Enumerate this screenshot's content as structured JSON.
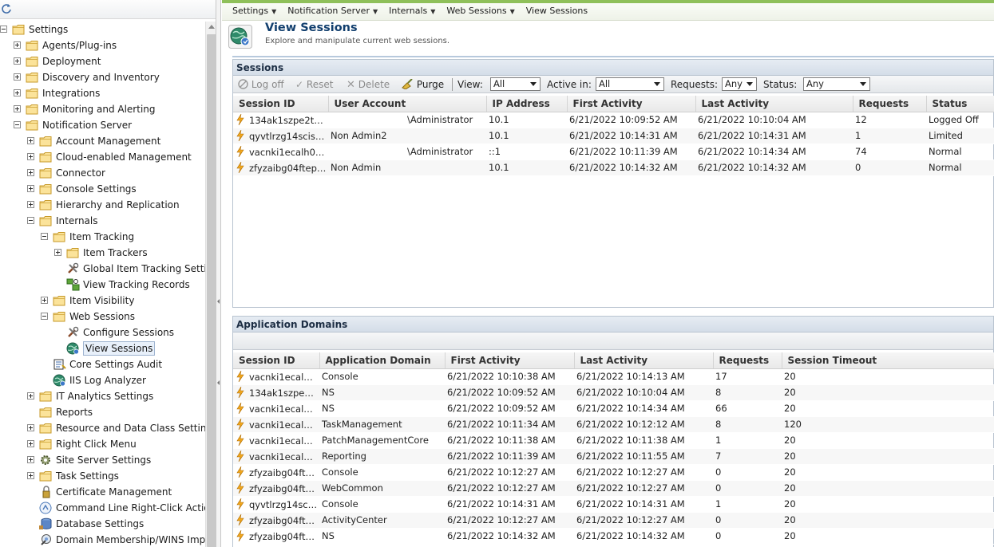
{
  "left_tree": {
    "items": [
      {
        "label": "Settings",
        "level": 0,
        "expander": "minus",
        "icon": "folder-icon"
      },
      {
        "label": "Agents/Plug-ins",
        "level": 1,
        "expander": "plus",
        "icon": "folder-icon"
      },
      {
        "label": "Deployment",
        "level": 1,
        "expander": "plus",
        "icon": "folder-icon"
      },
      {
        "label": "Discovery and Inventory",
        "level": 1,
        "expander": "plus",
        "icon": "folder-icon"
      },
      {
        "label": "Integrations",
        "level": 1,
        "expander": "plus",
        "icon": "folder-icon"
      },
      {
        "label": "Monitoring and Alerting",
        "level": 1,
        "expander": "plus",
        "icon": "folder-icon"
      },
      {
        "label": "Notification Server",
        "level": 1,
        "expander": "minus",
        "icon": "folder-icon"
      },
      {
        "label": "Account Management",
        "level": 2,
        "expander": "plus",
        "icon": "folder-icon"
      },
      {
        "label": "Cloud-enabled Management",
        "level": 2,
        "expander": "plus",
        "icon": "folder-icon"
      },
      {
        "label": "Connector",
        "level": 2,
        "expander": "plus",
        "icon": "folder-icon"
      },
      {
        "label": "Console Settings",
        "level": 2,
        "expander": "plus",
        "icon": "folder-icon"
      },
      {
        "label": "Hierarchy and Replication",
        "level": 2,
        "expander": "plus",
        "icon": "folder-icon"
      },
      {
        "label": "Internals",
        "level": 2,
        "expander": "minus",
        "icon": "folder-icon"
      },
      {
        "label": "Item Tracking",
        "level": 3,
        "expander": "minus",
        "icon": "folder-icon"
      },
      {
        "label": "Item Trackers",
        "level": 4,
        "expander": "plus",
        "icon": "folder-icon"
      },
      {
        "label": "Global Item Tracking Settin",
        "level": 4,
        "expander": "none",
        "icon": "tools-icon"
      },
      {
        "label": "View Tracking Records",
        "level": 4,
        "expander": "none",
        "icon": "records-icon"
      },
      {
        "label": "Item Visibility",
        "level": 3,
        "expander": "plus",
        "icon": "folder-icon"
      },
      {
        "label": "Web Sessions",
        "level": 3,
        "expander": "minus",
        "icon": "folder-icon"
      },
      {
        "label": "Configure Sessions",
        "level": 4,
        "expander": "none",
        "icon": "tools-icon"
      },
      {
        "label": "View Sessions",
        "level": 4,
        "expander": "none",
        "icon": "globe-icon",
        "selected": true
      },
      {
        "label": "Core Settings Audit",
        "level": 3,
        "expander": "none",
        "icon": "audit-icon"
      },
      {
        "label": "IIS Log Analyzer",
        "level": 3,
        "expander": "none",
        "icon": "globe-icon"
      },
      {
        "label": "IT Analytics Settings",
        "level": 2,
        "expander": "plus",
        "icon": "folder-icon"
      },
      {
        "label": "Reports",
        "level": 2,
        "expander": "none",
        "icon": "folder-icon"
      },
      {
        "label": "Resource and Data Class Settings",
        "level": 2,
        "expander": "plus",
        "icon": "folder-icon"
      },
      {
        "label": "Right Click Menu",
        "level": 2,
        "expander": "plus",
        "icon": "folder-icon"
      },
      {
        "label": "Site Server Settings",
        "level": 2,
        "expander": "plus",
        "icon": "gear-icon"
      },
      {
        "label": "Task Settings",
        "level": 2,
        "expander": "plus",
        "icon": "folder-icon"
      },
      {
        "label": "Certificate Management",
        "level": 2,
        "expander": "none",
        "icon": "certificate-icon"
      },
      {
        "label": "Command Line Right-Click Action",
        "level": 2,
        "expander": "none",
        "icon": "command-icon"
      },
      {
        "label": "Database Settings",
        "level": 2,
        "expander": "none",
        "icon": "database-icon"
      },
      {
        "label": "Domain Membership/WINS Impo",
        "level": 2,
        "expander": "none",
        "icon": "domain-icon"
      }
    ]
  },
  "breadcrumb": [
    {
      "label": "Settings",
      "has_menu": true
    },
    {
      "label": "Notification Server",
      "has_menu": true
    },
    {
      "label": "Internals",
      "has_menu": true
    },
    {
      "label": "Web Sessions",
      "has_menu": true
    },
    {
      "label": "View Sessions",
      "has_menu": false
    }
  ],
  "page": {
    "title": "View Sessions",
    "subtitle": "Explore and manipulate current web sessions.",
    "icon": "globe-icon"
  },
  "sessions_panel": {
    "title": "Sessions",
    "toolbar": {
      "log_off": "Log off",
      "reset": "Reset",
      "delete": "Delete",
      "purge": "Purge",
      "view_label": "View:",
      "view_value": "All",
      "active_in_label": "Active in:",
      "active_in_value": "All",
      "requests_label": "Requests:",
      "requests_value": "Any",
      "status_label": "Status:",
      "status_value": "Any"
    },
    "columns": [
      "Session ID",
      "User Account",
      "IP Address",
      "First Activity",
      "Last Activity",
      "Requests",
      "Status"
    ],
    "rows": [
      {
        "session_id": "134ak1szpe2t…",
        "user_account": "\\Administrator",
        "ip_address": "10.1",
        "first_activity": "6/21/2022 10:09:52 AM",
        "last_activity": "6/21/2022 10:10:04 AM",
        "requests": "12",
        "status": "Logged Off"
      },
      {
        "session_id": "qyvtlrzg14scis…",
        "user_account": "Non Admin2",
        "ip_address": "10.1",
        "first_activity": "6/21/2022 10:14:31 AM",
        "last_activity": "6/21/2022 10:14:31 AM",
        "requests": "1",
        "status": "Limited"
      },
      {
        "session_id": "vacnki1ecalh0…",
        "user_account": "\\Administrator",
        "ip_address": "::1",
        "first_activity": "6/21/2022 10:11:39 AM",
        "last_activity": "6/21/2022 10:14:34 AM",
        "requests": "74",
        "status": "Normal"
      },
      {
        "session_id": "zfyzaibg04ftep…",
        "user_account": "Non Admin",
        "ip_address": "10.1",
        "first_activity": "6/21/2022 10:14:32 AM",
        "last_activity": "6/21/2022 10:14:32 AM",
        "requests": "0",
        "status": "Normal"
      }
    ]
  },
  "domains_panel": {
    "title": "Application Domains",
    "columns": [
      "Session ID",
      "Application Domain",
      "First Activity",
      "Last Activity",
      "Requests",
      "Session Timeout"
    ],
    "rows": [
      {
        "session_id": "vacnki1ecal…",
        "app_domain": "Console",
        "first_activity": "6/21/2022 10:10:38 AM",
        "last_activity": "6/21/2022 10:14:13 AM",
        "requests": "17",
        "timeout": "20"
      },
      {
        "session_id": "134ak1szpe…",
        "app_domain": "NS",
        "first_activity": "6/21/2022 10:09:52 AM",
        "last_activity": "6/21/2022 10:10:04 AM",
        "requests": "8",
        "timeout": "20"
      },
      {
        "session_id": "vacnki1ecal…",
        "app_domain": "NS",
        "first_activity": "6/21/2022 10:09:52 AM",
        "last_activity": "6/21/2022 10:14:34 AM",
        "requests": "66",
        "timeout": "20"
      },
      {
        "session_id": "vacnki1ecal…",
        "app_domain": "TaskManagement",
        "first_activity": "6/21/2022 10:11:34 AM",
        "last_activity": "6/21/2022 10:12:12 AM",
        "requests": "8",
        "timeout": "120"
      },
      {
        "session_id": "vacnki1ecal…",
        "app_domain": "PatchManagementCore",
        "first_activity": "6/21/2022 10:11:38 AM",
        "last_activity": "6/21/2022 10:11:38 AM",
        "requests": "1",
        "timeout": "20"
      },
      {
        "session_id": "vacnki1ecal…",
        "app_domain": "Reporting",
        "first_activity": "6/21/2022 10:11:39 AM",
        "last_activity": "6/21/2022 10:11:55 AM",
        "requests": "7",
        "timeout": "20"
      },
      {
        "session_id": "zfyzaibg04ft…",
        "app_domain": "Console",
        "first_activity": "6/21/2022 10:12:27 AM",
        "last_activity": "6/21/2022 10:12:27 AM",
        "requests": "0",
        "timeout": "20"
      },
      {
        "session_id": "zfyzaibg04ft…",
        "app_domain": "WebCommon",
        "first_activity": "6/21/2022 10:12:27 AM",
        "last_activity": "6/21/2022 10:12:27 AM",
        "requests": "0",
        "timeout": "20"
      },
      {
        "session_id": "qyvtlrzg14sc…",
        "app_domain": "Console",
        "first_activity": "6/21/2022 10:14:31 AM",
        "last_activity": "6/21/2022 10:14:31 AM",
        "requests": "1",
        "timeout": "20"
      },
      {
        "session_id": "zfyzaibg04ft…",
        "app_domain": "ActivityCenter",
        "first_activity": "6/21/2022 10:12:27 AM",
        "last_activity": "6/21/2022 10:12:27 AM",
        "requests": "0",
        "timeout": "20"
      },
      {
        "session_id": "zfyzaibg04ft…",
        "app_domain": "NS",
        "first_activity": "6/21/2022 10:14:32 AM",
        "last_activity": "6/21/2022 10:14:32 AM",
        "requests": "0",
        "timeout": "20"
      }
    ]
  },
  "colors": {
    "breadcrumb_accent": "#8fc05a",
    "title_color": "#123f6e",
    "folder_fill": "#fbe39a",
    "folder_stroke": "#c79a2a",
    "bolt_color": "#f2a81d"
  }
}
